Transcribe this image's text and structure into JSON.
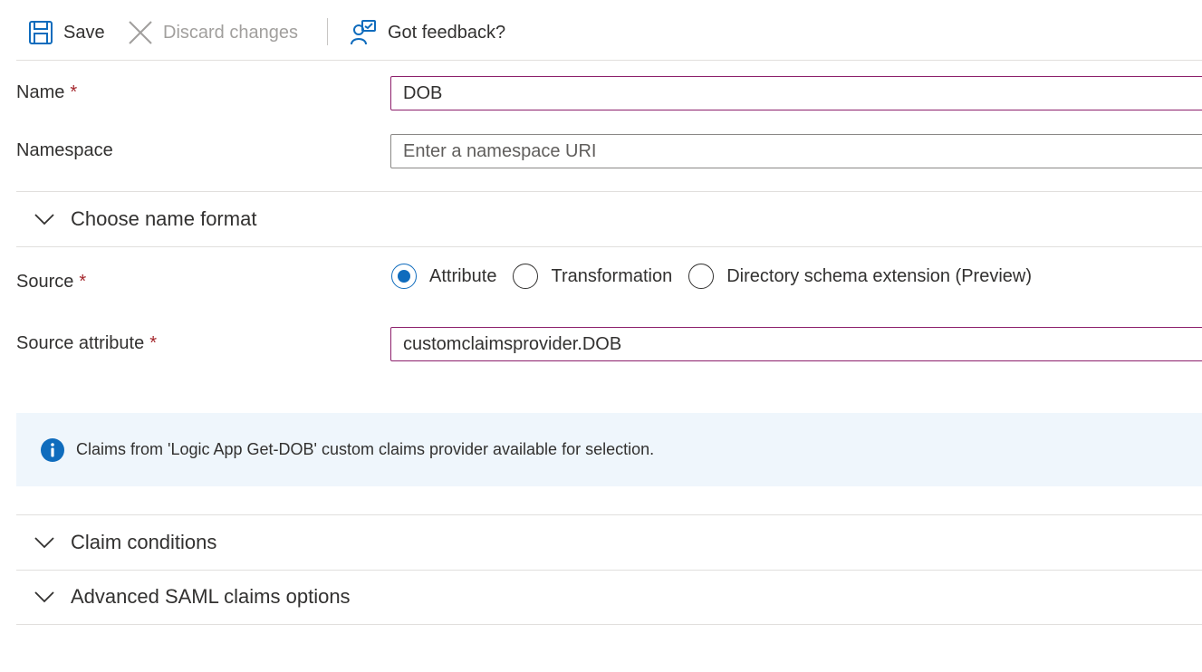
{
  "toolbar": {
    "save_label": "Save",
    "discard_label": "Discard changes",
    "feedback_label": "Got feedback?"
  },
  "form": {
    "name": {
      "label": "Name",
      "required_mark": "*",
      "value": "DOB"
    },
    "namespace": {
      "label": "Namespace",
      "placeholder": "Enter a namespace URI",
      "value": ""
    },
    "name_format_section": "Choose name format",
    "source": {
      "label": "Source",
      "required_mark": "*",
      "options": [
        "Attribute",
        "Transformation",
        "Directory schema extension (Preview)"
      ],
      "selected": "Attribute"
    },
    "source_attribute": {
      "label": "Source attribute",
      "required_mark": "*",
      "value": "customclaimsprovider.DOB"
    }
  },
  "info_banner": {
    "icon": "info-icon",
    "message": "Claims from 'Logic App Get-DOB' custom claims provider available for selection."
  },
  "sections": {
    "claim_conditions": "Claim conditions",
    "advanced_saml": "Advanced SAML claims options"
  },
  "colors": {
    "accent_blue": "#0f6cbd",
    "focus_border": "#8c1f6b",
    "required_red": "#a4262c",
    "info_background": "#eff6fc"
  }
}
